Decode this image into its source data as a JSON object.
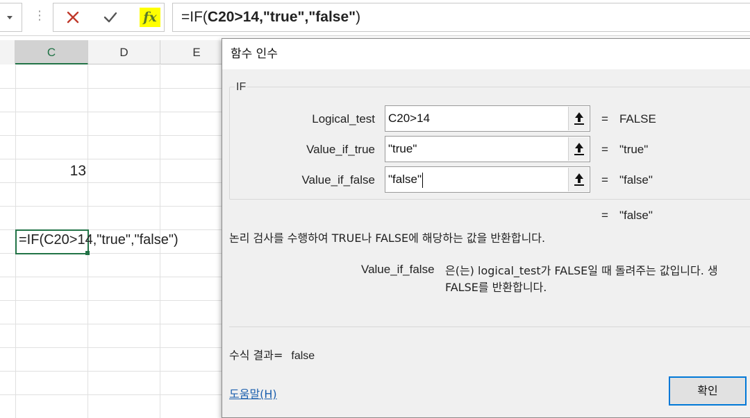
{
  "formula_bar": {
    "formula_prefix": "=IF(",
    "formula_bold": "C20>14,\"true\",\"false\"",
    "formula_suffix": ")",
    "cancel_icon": "x-icon",
    "enter_icon": "checkmark-icon",
    "fx_label": "fx",
    "fx_highlight_color": "#ffff00"
  },
  "grid": {
    "columns": [
      "C",
      "D",
      "E"
    ],
    "selected_column": "C",
    "cells": {
      "c_value": "13",
      "active_formula": "=IF(C20>14,\"true\",\"false\")"
    },
    "accent_color": "#217346"
  },
  "dialog": {
    "title": "함수 인수",
    "function_name": "IF",
    "arguments": [
      {
        "label": "Logical_test",
        "value": "C20>14",
        "result": "FALSE"
      },
      {
        "label": "Value_if_true",
        "value": "\"true\"",
        "result": "\"true\""
      },
      {
        "label": "Value_if_false",
        "value": "\"false\"",
        "result": "\"false\""
      }
    ],
    "equals_sign": "=",
    "overall_result": "\"false\"",
    "description": "논리 검사를 수행하여 TRUE나 FALSE에 해당하는 값을 반환합니다.",
    "arg_help_name": "Value_if_false",
    "arg_help_line1": "은(는) logical_test가 FALSE일 때 돌려주는 값입니다. 생",
    "arg_help_line2": "FALSE를 반환합니다.",
    "formula_result_label": "수식 결과=",
    "formula_result_value": "false",
    "help_link": "도움말(H)",
    "ok_label": "확인",
    "ref_button_icon": "collapse-dialog-icon"
  }
}
